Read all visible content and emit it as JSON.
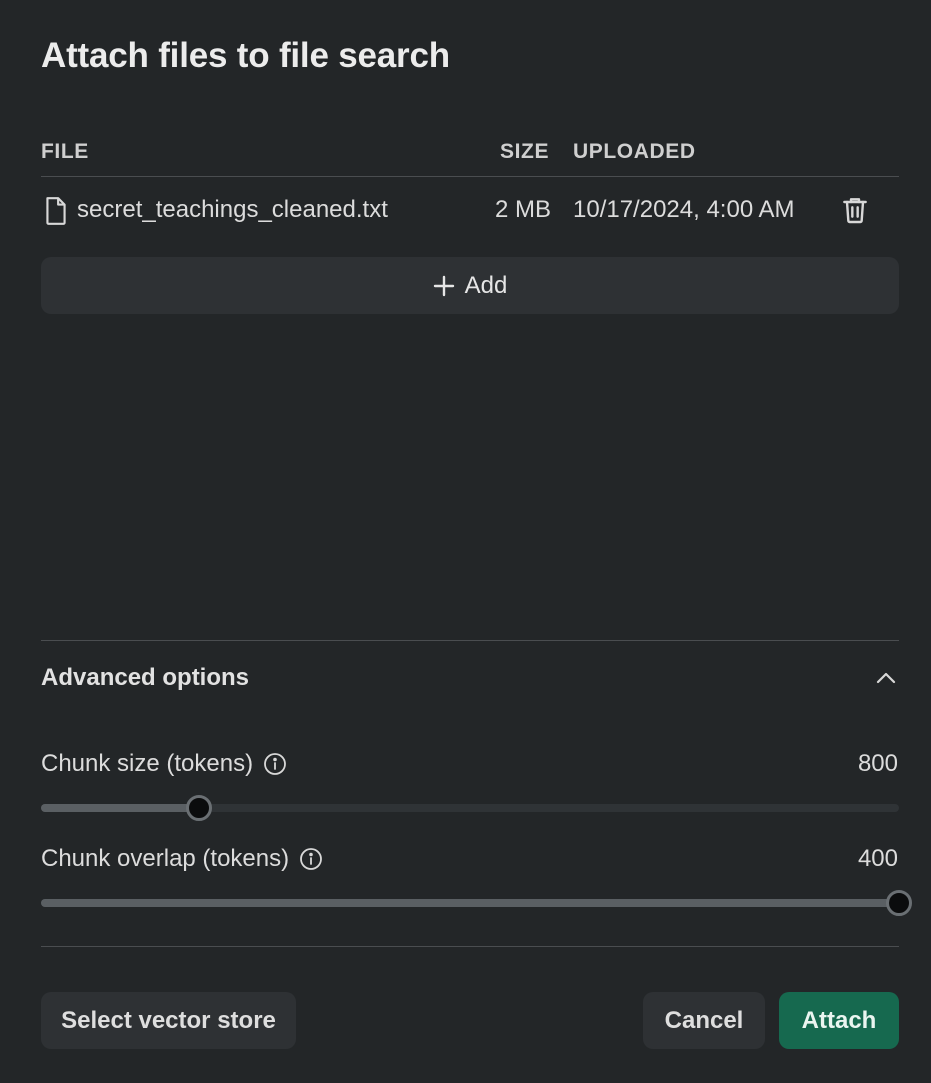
{
  "dialog": {
    "title": "Attach files to file search"
  },
  "table": {
    "headers": {
      "file": "FILE",
      "size": "SIZE",
      "uploaded": "UPLOADED"
    },
    "rows": [
      {
        "name": "secret_teachings_cleaned.txt",
        "size": "2 MB",
        "uploaded": "10/17/2024, 4:00 AM",
        "icon": "file-icon",
        "action_icon": "trash-icon"
      }
    ]
  },
  "add_button": {
    "label": "Add",
    "icon": "plus-icon"
  },
  "advanced": {
    "label": "Advanced options",
    "expanded": true,
    "icon": "chevron-up-icon"
  },
  "sliders": {
    "chunk_size": {
      "label": "Chunk size (tokens)",
      "value": "800",
      "fraction": 0.184,
      "icon": "info-icon"
    },
    "chunk_overlap": {
      "label": "Chunk overlap (tokens)",
      "value": "400",
      "fraction": 1.0,
      "icon": "info-icon"
    }
  },
  "footer": {
    "select_vector_store_label": "Select vector store",
    "cancel_label": "Cancel",
    "attach_label": "Attach"
  },
  "colors": {
    "background": "#232628",
    "primary": "#16694f",
    "secondary_button": "#2e3134",
    "divider": "#4a4d50"
  }
}
